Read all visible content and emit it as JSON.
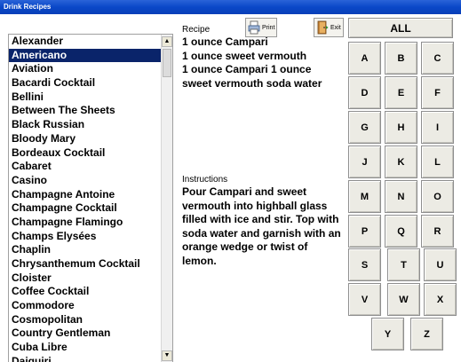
{
  "window": {
    "title": "Drink Recipes"
  },
  "toolbar": {
    "print_label": "Print",
    "exit_label": "Exit",
    "all_label": "ALL"
  },
  "recipe": {
    "label": "Recipe",
    "lines": [
      "1 ounce Campari",
      "1 ounce sweet vermouth",
      "1 ounce Campari 1 ounce",
      "sweet vermouth soda water"
    ]
  },
  "instructions": {
    "label": "Instructions",
    "text": "Pour Campari and sweet vermouth into highball glass filled with ice and stir. Top with soda water and garnish with an orange wedge or twist of lemon."
  },
  "drinks": {
    "selected": "Americano",
    "items": [
      "Alexander",
      "Americano",
      "Aviation",
      "Bacardi Cocktail",
      "Bellini",
      "Between The Sheets",
      "Black Russian",
      "Bloody Mary",
      "Bordeaux Cocktail",
      "Cabaret",
      "Casino",
      "Champagne Antoine",
      "Champagne Cocktail",
      "Champagne Flamingo",
      "Champs Elysées",
      "Chaplin",
      "Chrysanthemum Cocktail",
      "Cloister",
      "Coffee Cocktail",
      "Commodore",
      "Cosmopolitan",
      "Country Gentleman",
      "Cuba Libre",
      "Daiquiri"
    ]
  },
  "letters": [
    "A",
    "B",
    "C",
    "D",
    "E",
    "F",
    "G",
    "H",
    "I",
    "J",
    "K",
    "L",
    "M",
    "N",
    "O",
    "P",
    "Q",
    "R",
    "S",
    "T",
    "U",
    "V",
    "W",
    "X",
    "Y",
    "Z"
  ]
}
